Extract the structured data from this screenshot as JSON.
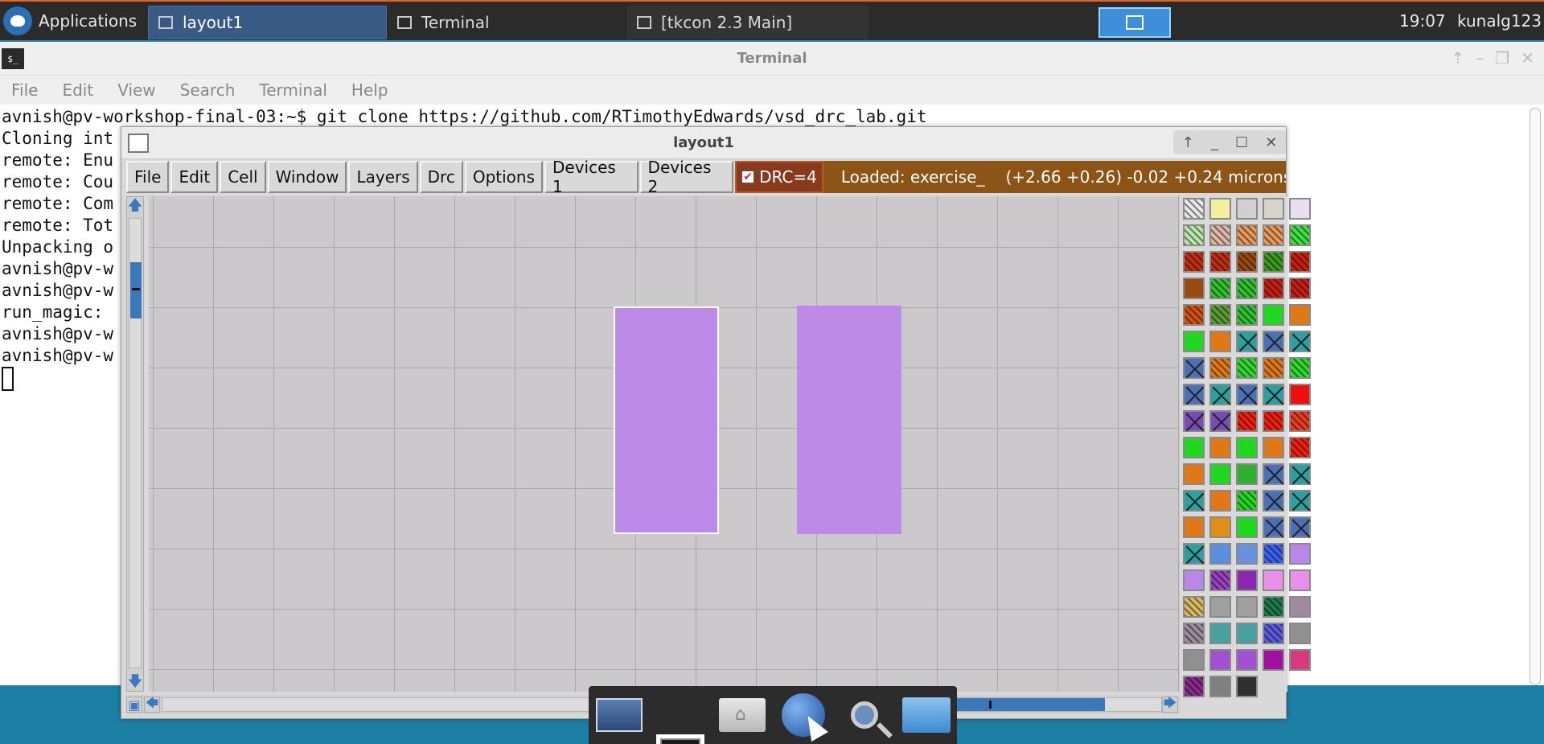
{
  "top_panel": {
    "applications_label": "Applications",
    "tasks": [
      {
        "label": "layout1"
      },
      {
        "label": "Terminal"
      },
      {
        "label": "[tkcon 2.3 Main]"
      }
    ],
    "clock": "19:07",
    "user": "kunalg123"
  },
  "terminal": {
    "title": "Terminal",
    "menu": [
      "File",
      "Edit",
      "View",
      "Search",
      "Terminal",
      "Help"
    ],
    "lines": [
      "avnish@pv-workshop-final-03:~$ git clone https://github.com/RTimothyEdwards/vsd_drc_lab.git",
      "Cloning int",
      "remote: Enu",
      "remote: Cou",
      "remote: Com",
      "remote: Tot",
      "Unpacking o",
      "avnish@pv-w",
      "avnish@pv-w",
      "run_magic: ",
      "avnish@pv-w",
      "avnish@pv-w"
    ]
  },
  "layout_window": {
    "title": "layout1",
    "menu": [
      "File",
      "Edit",
      "Cell",
      "Window",
      "Layers",
      "Drc",
      "Options",
      "Devices 1",
      "Devices 2"
    ],
    "drc_label": "DRC=4",
    "drc_checked": true,
    "status_loaded": "Loaded: exercise_",
    "status_coords": "(+2.66 +0.26) -0.02 +0.24 microns",
    "palette_colors": [
      "#e8e8e8",
      "#f4f0a0",
      "#d0d0d0",
      "#d8d4c8",
      "#e8e0f0",
      "#b8e8b0",
      "#e0b8a8",
      "#e89858",
      "#e89858",
      "#40e040",
      "#c03010",
      "#c03010",
      "#9a4a10",
      "#3a9a20",
      "#c82010",
      "#9a4a10",
      "#30c030",
      "#30c030",
      "#c82010",
      "#c82010",
      "#d05010",
      "#5a9a30",
      "#30c030",
      "#20d820",
      "#e07818",
      "#20d820",
      "#e07818",
      "#2aa0a0",
      "#4a70b8",
      "#2aa0a0",
      "#4a70b8",
      "#e07818",
      "#30d830",
      "#e07818",
      "#30d830",
      "#4a70b8",
      "#2aa0a0",
      "#4a70b8",
      "#2aa0a0",
      "#ee1010",
      "#7a4ab8",
      "#7a4ab8",
      "#ee2010",
      "#ee2010",
      "#ee3a20",
      "#20d820",
      "#e07818",
      "#20d820",
      "#e07818",
      "#ee2010",
      "#e07818",
      "#20d820",
      "#30b030",
      "#4a70b8",
      "#2aa0a0",
      "#2aa0a0",
      "#e07818",
      "#20d820",
      "#4a70b8",
      "#2aa0a0",
      "#e07818",
      "#e09018",
      "#20d820",
      "#4a70b8",
      "#4a70b8",
      "#2aa0a0",
      "#5a8ee0",
      "#6a90e0",
      "#3a60f0",
      "#b888e8",
      "#b888e8",
      "#9a40c0",
      "#8a28b0",
      "#e890e8",
      "#e890e8",
      "#d8b860",
      "#a0a0a0",
      "#a0a0a0",
      "#1a7a4a",
      "#a08aa0",
      "#a08aa0",
      "#48a0a0",
      "#48a0a0",
      "#5a5ae0",
      "#909090",
      "#909090",
      "#a050d0",
      "#a050d0",
      "#a010a0",
      "#d83a80",
      "#8a2a8a",
      "#808080",
      "#303030"
    ],
    "palette_crossed": [
      27,
      28,
      29,
      30,
      35,
      36,
      37,
      38,
      40,
      41,
      53,
      54,
      55,
      58,
      59,
      63,
      64,
      65
    ],
    "palette_hatched": [
      0,
      5,
      6,
      7,
      8,
      9,
      10,
      11,
      12,
      13,
      14,
      16,
      17,
      18,
      19,
      20,
      21,
      22,
      31,
      32,
      33,
      34,
      42,
      43,
      44,
      49,
      57,
      68,
      71,
      75,
      78,
      80,
      83,
      90
    ]
  },
  "dock": {
    "items": [
      "screen-icon",
      "terminal-icon",
      "home-folder-icon",
      "web-browser-icon",
      "search-icon",
      "folder-icon"
    ]
  }
}
